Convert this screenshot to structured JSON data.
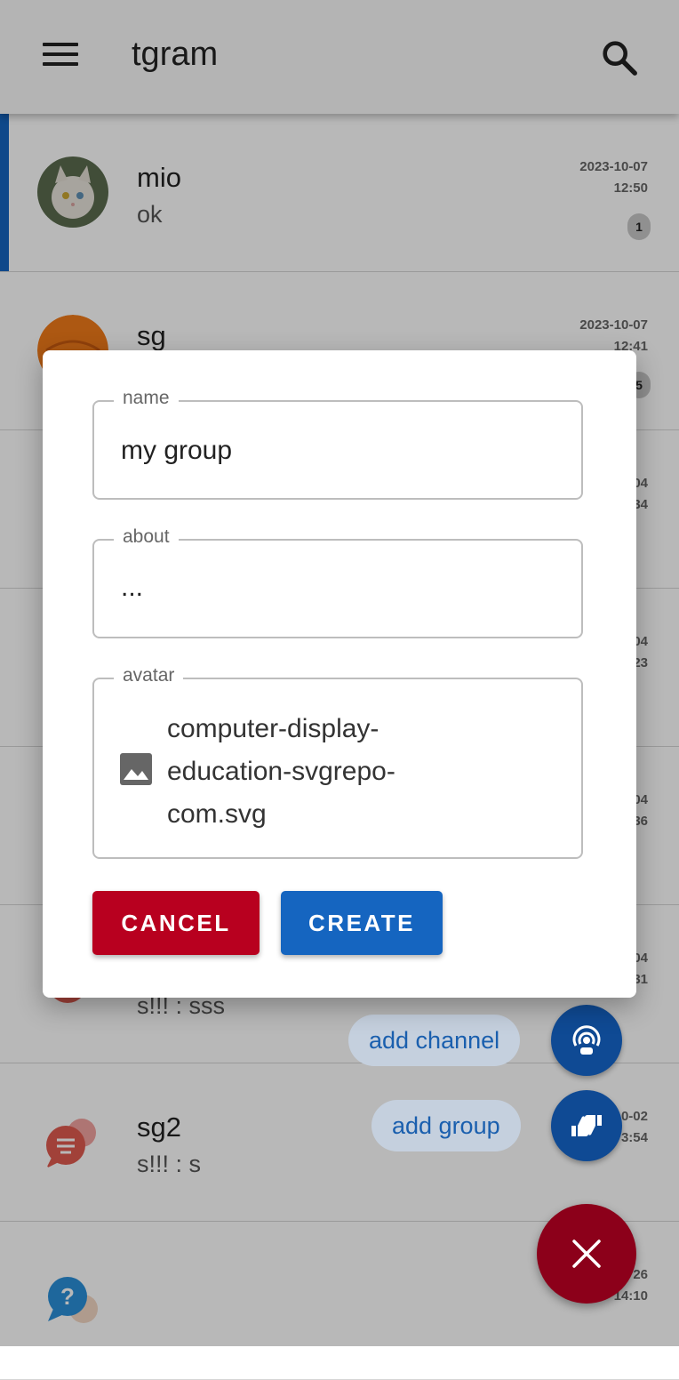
{
  "app": {
    "title": "tgram"
  },
  "chats": [
    {
      "name": "mio",
      "message": "ok",
      "date": "2023-10-07",
      "time": "12:50",
      "badge": "1"
    },
    {
      "name": "sg",
      "message": "",
      "date": "2023-10-07",
      "time": "12:41",
      "badge": "5"
    },
    {
      "name": "",
      "message": "",
      "date": "04",
      "time": "34",
      "badge": ""
    },
    {
      "name": "",
      "message": "",
      "date": "04",
      "time": "23",
      "badge": ""
    },
    {
      "name": "",
      "message": "",
      "date": "04",
      "time": "36",
      "badge": ""
    },
    {
      "name": "",
      "message": "s!!! : sss",
      "date": "04",
      "time": "31",
      "badge": ""
    },
    {
      "name": "sg2",
      "message": "s!!! : s",
      "date": "0-02",
      "time": "3:54",
      "badge": ""
    },
    {
      "name": "",
      "message": "",
      "date": "26",
      "time": "14:10",
      "badge": ""
    }
  ],
  "speed_dial": {
    "add_channel": "add channel",
    "add_group": "add group"
  },
  "dialog": {
    "name_label": "name",
    "name_value": "my group",
    "about_label": "about",
    "about_value": "...",
    "avatar_label": "avatar",
    "avatar_file": "computer-display-education-svgrepo-com.svg",
    "cancel": "CANCEL",
    "create": "CREATE"
  },
  "colors": {
    "primary": "#1565c0",
    "danger": "#b8001f",
    "fab": "#8c001a"
  }
}
